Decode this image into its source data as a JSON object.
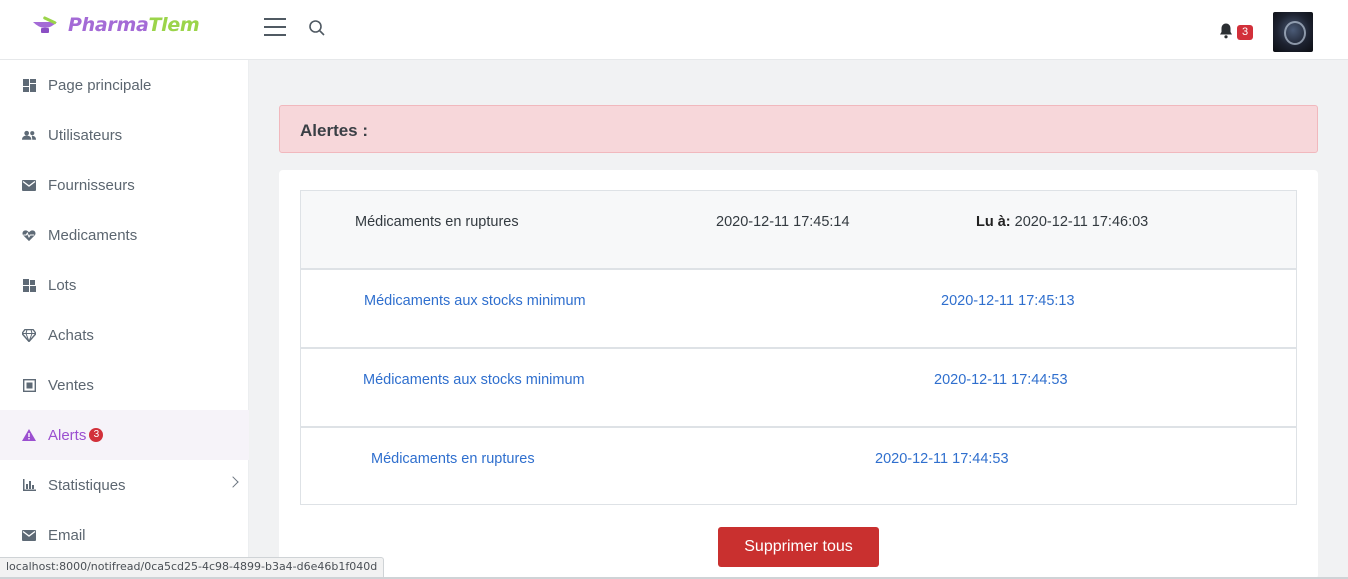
{
  "brand": {
    "part1": "Pharma",
    "part2": "Tlem"
  },
  "header": {
    "notification_count": "3"
  },
  "sidebar": {
    "items": [
      {
        "label": "Page principale",
        "icon": "dashboard-icon"
      },
      {
        "label": "Utilisateurs",
        "icon": "users-icon"
      },
      {
        "label": "Fournisseurs",
        "icon": "mail-icon"
      },
      {
        "label": "Medicaments",
        "icon": "heart-pulse-icon"
      },
      {
        "label": "Lots",
        "icon": "boxes-icon"
      },
      {
        "label": "Achats",
        "icon": "diamond-icon"
      },
      {
        "label": "Ventes",
        "icon": "receipt-icon"
      },
      {
        "label": "Alerts",
        "icon": "warning-icon",
        "badge": "3",
        "active": true
      },
      {
        "label": "Statistiques",
        "icon": "bar-chart-icon"
      },
      {
        "label": "Email",
        "icon": "mail-icon"
      }
    ]
  },
  "main": {
    "heading": "Alertes :",
    "alerts": [
      {
        "title": "Médicaments en ruptures",
        "date": "2020-12-11 17:45:14",
        "read_label": "Lu à:",
        "read_date": "2020-12-11 17:46:03",
        "read": true
      },
      {
        "title": "Médicaments aux stocks minimum",
        "date": "2020-12-11 17:45:13",
        "read": false
      },
      {
        "title": "Médicaments aux stocks minimum",
        "date": "2020-12-11 17:44:53",
        "read": false
      },
      {
        "title": "Médicaments en ruptures",
        "date": "2020-12-11 17:44:53",
        "read": false
      }
    ],
    "delete_all_label": "Supprimer tous"
  },
  "statusbar": {
    "url": "localhost:8000/notifread/0ca5cd25-4c98-4899-b3a4-d6e46b1f040d"
  },
  "colors": {
    "accent": "#9b4fd0",
    "brand_green": "#9bd44a",
    "danger": "#c9302f",
    "link": "#2f6fce",
    "alert_bg": "#f7d7da"
  }
}
